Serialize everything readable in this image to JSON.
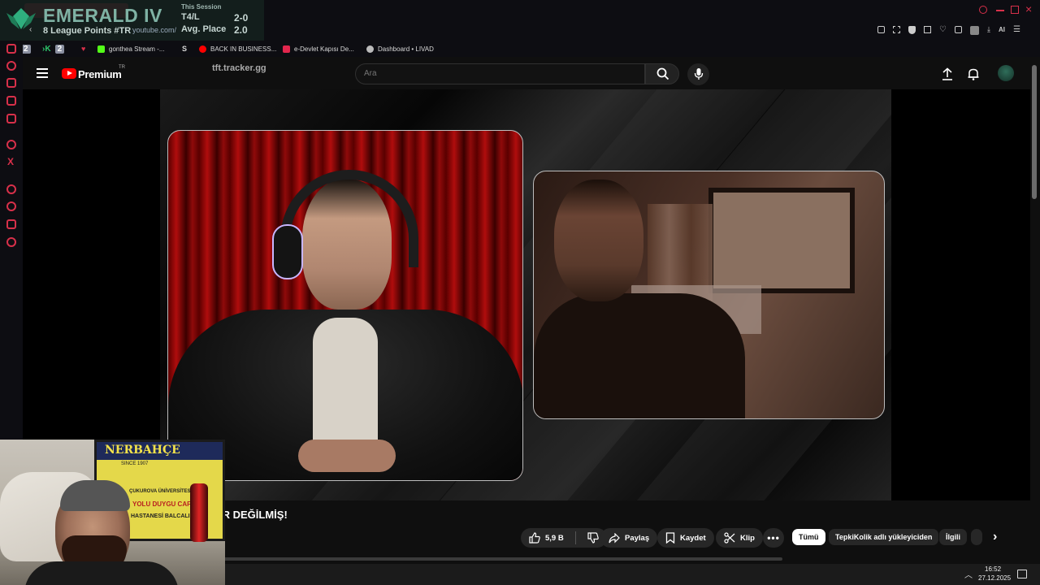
{
  "overlay": {
    "rank": "EMERALD IV",
    "lp": "8 League Points #TR",
    "session_label": "This Session",
    "stat1_label": "T4/L",
    "stat1_value": "2-0",
    "stat2_label": "Avg. Place",
    "stat2_value": "2.0",
    "url_fragment": "youtube.com/"
  },
  "bookmarks": [
    {
      "label": "2"
    },
    {
      "label": "2"
    },
    {
      "label": "gonthea Stream -..."
    },
    {
      "label": "BACK IN BUSINESS..."
    },
    {
      "label": "e-Devlet Kapısı De..."
    },
    {
      "label": "Dashboard • LIVAD"
    }
  ],
  "browser": {
    "ai_label": "AI"
  },
  "youtube": {
    "brand": "Premium",
    "country": "TR",
    "overlay_text": "tft.tracker.gg",
    "search_placeholder": "Ara",
    "video_title": "IR DEĞİLMİŞ!",
    "like_count": "5,9 B",
    "share_label": "Paylaş",
    "save_label": "Kaydet",
    "clip_label": "Klip",
    "chips": [
      "Tümü",
      "TepkiKolik adlı yükleyiciden",
      "İlgili"
    ]
  },
  "webcam_sign": {
    "line1": "ÇUKUROVA ÜNİVERSİTESİ",
    "line2": "YOLU DUYGU CAFE",
    "line3": "HASTANESİ BALCALI",
    "top": "NERBAHÇE",
    "since": "SINCE 1907"
  },
  "taskbar": {
    "time": "16:52",
    "date": "27.12.2025"
  },
  "colors": {
    "yt_red": "#ff0000",
    "overlay_green": "#7fb2a4",
    "sidebar_accent": "#d8304a"
  }
}
